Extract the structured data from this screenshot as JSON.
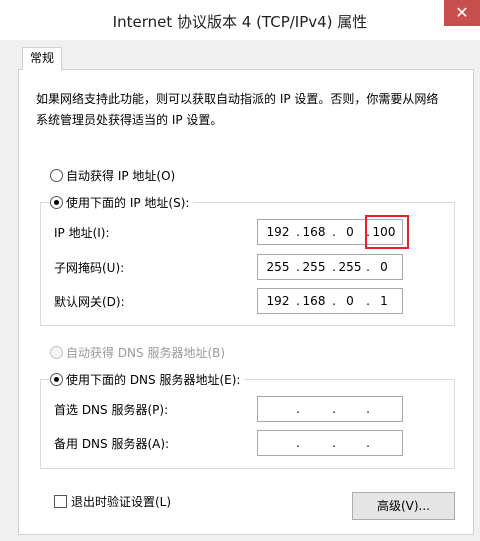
{
  "window": {
    "title": "Internet 协议版本 4 (TCP/IPv4) 属性",
    "close_glyph": "✕"
  },
  "tab": {
    "label": "常规"
  },
  "description": "如果网络支持此功能，则可以获取自动指派的 IP 设置。否则，你需要从网络系统管理员处获得适当的 IP 设置。",
  "ip_section": {
    "auto_option": "自动获得 IP 地址(O)",
    "manual_option": "使用下面的 IP 地址(S):",
    "selected": "manual",
    "fields": {
      "ip_label": "IP 地址(I):",
      "ip_value": [
        "192",
        "168",
        "0",
        "100"
      ],
      "mask_label": "子网掩码(U):",
      "mask_value": [
        "255",
        "255",
        "255",
        "0"
      ],
      "gateway_label": "默认网关(D):",
      "gateway_value": [
        "192",
        "168",
        "0",
        "1"
      ]
    }
  },
  "dns_section": {
    "auto_option": "自动获得 DNS 服务器地址(B)",
    "manual_option": "使用下面的 DNS 服务器地址(E):",
    "selected": "manual",
    "preferred_label": "首选 DNS 服务器(P):",
    "preferred_value": [
      "",
      "",
      "",
      ""
    ],
    "alternate_label": "备用 DNS 服务器(A):",
    "alternate_value": [
      "",
      "",
      "",
      ""
    ]
  },
  "footer": {
    "validate_label": "退出时验证设置(L)",
    "validate_checked": false,
    "advanced_button": "高级(V)..."
  },
  "colors": {
    "highlight": "#e2242a",
    "close_button": "#c7504f"
  }
}
